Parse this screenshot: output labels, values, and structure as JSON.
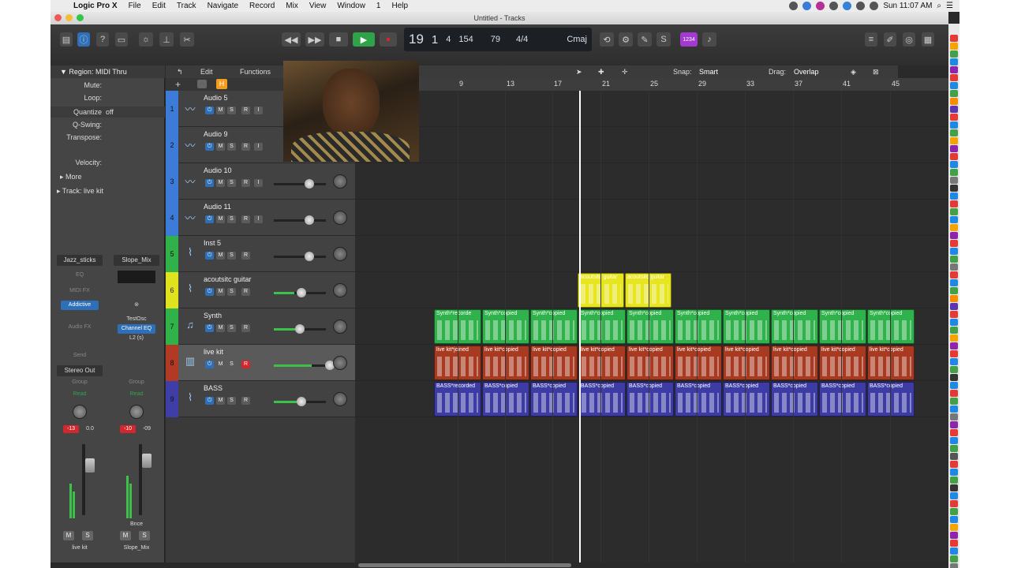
{
  "menubar": {
    "app_name": "Logic Pro X",
    "items": [
      "File",
      "Edit",
      "Track",
      "Navigate",
      "Record",
      "Mix",
      "View",
      "Window",
      "1",
      "Help"
    ],
    "clock": "Sun 11:07 AM"
  },
  "window": {
    "title": "Untitled - Tracks"
  },
  "lcd": {
    "bar": "19",
    "beat": "1",
    "div": "4",
    "tick": "154",
    "tempo": "79",
    "time_sig": "4/4",
    "key": "Cmaj"
  },
  "control_bar": {
    "count_in_label": "1234"
  },
  "inspector": {
    "region_header": "Region: MIDI Thru",
    "mute_label": "Mute:",
    "loop_label": "Loop:",
    "quantize_label": "Quantize",
    "quantize_value": "off",
    "qswing_label": "Q-Swing:",
    "transpose_label": "Transpose:",
    "velocity_label": "Velocity:",
    "more_label": "More",
    "track_header": "Track:",
    "track_value": "live kit",
    "strip1": {
      "setting": "Jazz_sticks",
      "eq": "EQ",
      "midi_fx": "MIDI FX",
      "instrument": "Addictive",
      "audio_fx": "Audio FX",
      "send": "Send",
      "output": "Stereo Out",
      "group": "Group",
      "automation": "Read",
      "vol": "-13",
      "pan": "0.0",
      "name": "live kit",
      "mute": "M",
      "solo": "S"
    },
    "strip2": {
      "setting": "Slope_Mix",
      "input": "TestOsc",
      "plugin": "Channel EQ",
      "bus": "L2 (s)",
      "group": "Group",
      "automation": "Read",
      "vol": "-10",
      "pan": "-09",
      "bounce": "Bnce",
      "name": "Slope_Mix",
      "mute": "M",
      "solo": "S"
    }
  },
  "track_header_bar": {
    "edit": "Edit",
    "functions": "Functions",
    "snap_label": "Snap:",
    "snap_value": "Smart",
    "drag_label": "Drag:",
    "drag_value": "Overlap",
    "add_button": "+",
    "h_button": "H"
  },
  "tracks": [
    {
      "num": "1",
      "name": "Audio 5",
      "type": "audio",
      "color": "#3d7bd9",
      "rec": "R",
      "input": "I"
    },
    {
      "num": "2",
      "name": "Audio 9",
      "type": "audio",
      "color": "#3d7bd9",
      "rec": "R",
      "input": "I"
    },
    {
      "num": "3",
      "name": "Audio 10",
      "type": "audio",
      "color": "#3d7bd9",
      "rec": "R",
      "input": "I"
    },
    {
      "num": "4",
      "name": "Audio 11",
      "type": "audio",
      "color": "#3d7bd9",
      "rec": "R",
      "input": "I"
    },
    {
      "num": "5",
      "name": "Inst 5",
      "type": "inst",
      "color": "#31b14a",
      "rec": "R",
      "input": ""
    },
    {
      "num": "6",
      "name": "acoutsitc guitar",
      "type": "inst",
      "color": "#e0e21e",
      "rec": "R",
      "input": ""
    },
    {
      "num": "7",
      "name": "Synth",
      "type": "inst",
      "color": "#31b14a",
      "rec": "R",
      "input": ""
    },
    {
      "num": "8",
      "name": "live kit",
      "type": "drum",
      "color": "#b23a24",
      "rec": "R",
      "input": ""
    },
    {
      "num": "9",
      "name": "BASS",
      "type": "inst",
      "color": "#3e3ea6",
      "rec": "R",
      "input": ""
    }
  ],
  "track_buttons": {
    "mute": "M",
    "solo": "S"
  },
  "ruler": {
    "bars": [
      "9",
      "13",
      "17",
      "21",
      "25",
      "29",
      "33",
      "37",
      "41",
      "45"
    ]
  },
  "regions": {
    "acoustic": [
      "acoutsitc guitar",
      "acoutsitc guitar"
    ],
    "synth": [
      "Synth*recorde",
      "Synth*copied",
      "Synth*copied",
      "Synth*copied",
      "Synth*copied",
      "Synth*copied",
      "Synth*copied",
      "Synth*copied",
      "Synth*copied",
      "Synth*copied"
    ],
    "live_kit": [
      "live kit*joined",
      "live kit*copied",
      "live kit*copied",
      "live kit*copied",
      "live kit*copied",
      "live kit*copied",
      "live kit*copied",
      "live kit*copied",
      "live kit*copied",
      "live kit*copied"
    ],
    "bass": [
      "BASS*recorded",
      "BASS*copied",
      "BASS*copied",
      "BASS*copied",
      "BASS*copied",
      "BASS*copied",
      "BASS*copied",
      "BASS*copied",
      "BASS*copied",
      "BASS*copied"
    ]
  },
  "colors": {
    "accent_blue": "#2d6fb8",
    "record_red": "#d3272d",
    "play_green": "#2ea34a",
    "synth_green": "#2fb14b",
    "acoustic_yellow": "#e6e51f",
    "livekit_red": "#a83a22",
    "bass_purple": "#3d3ca5"
  }
}
